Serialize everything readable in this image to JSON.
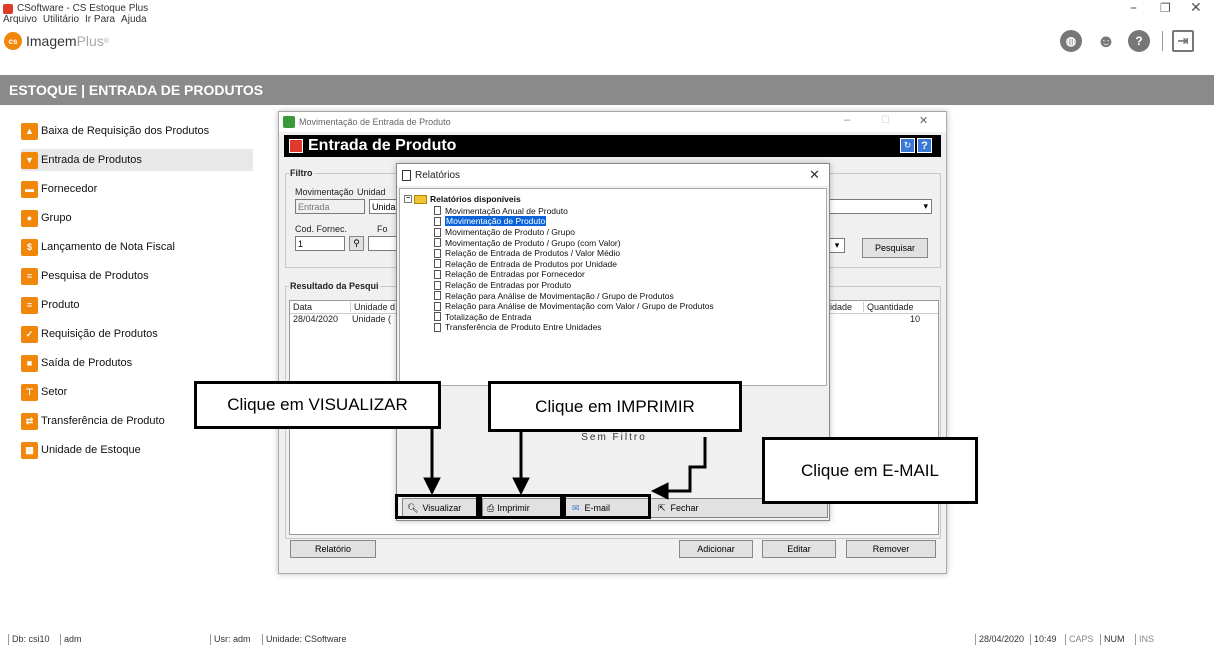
{
  "app": {
    "title": "CSoftware - CS Estoque Plus",
    "menu": [
      "Arquivo",
      "Utilitário",
      "Ir Para",
      "Ajuda"
    ],
    "brand_a": "Imagem",
    "brand_b": "Plus",
    "brand_mark": "®"
  },
  "banner": "ESTOQUE | ENTRADA DE PRODUTOS",
  "sidebar": [
    {
      "label": "Baixa de Requisição dos Produtos",
      "icon": "box-up-icon"
    },
    {
      "label": "Entrada de Produtos",
      "icon": "box-open-icon"
    },
    {
      "label": "Fornecedor",
      "icon": "truck-icon"
    },
    {
      "label": "Grupo",
      "icon": "people-icon"
    },
    {
      "label": "Lançamento de Nota Fiscal",
      "icon": "dollar-icon"
    },
    {
      "label": "Pesquisa de Produtos",
      "icon": "database-icon"
    },
    {
      "label": "Produto",
      "icon": "database-icon"
    },
    {
      "label": "Requisição de Produtos",
      "icon": "check-icon"
    },
    {
      "label": "Saída de Produtos",
      "icon": "box-out-icon"
    },
    {
      "label": "Setor",
      "icon": "org-chart-icon"
    },
    {
      "label": "Transferência de Produto",
      "icon": "transfer-icon"
    },
    {
      "label": "Unidade de Estoque",
      "icon": "stock-icon"
    }
  ],
  "movwin": {
    "title": "Movimentação de Entrada de Produto",
    "heading": "Entrada de Produto",
    "filtro": "Filtro",
    "mov_label": "Movimentação",
    "mov_value": "Entrada",
    "unid_label": "Unidad",
    "unid_value": "Unida",
    "cod_label": "Cod. Fornec.",
    "cod_value": "1",
    "fo_label": "Fo",
    "pesquisar": "Pesquisar",
    "resultado": "Resultado da Pesqui",
    "cols": [
      "Data",
      "Unidade d",
      "idade",
      "Quantidade"
    ],
    "row": {
      "data": "28/04/2020",
      "unidade": "Unidade (",
      "qtd": "10"
    },
    "buttons": {
      "relatorio": "Relatório",
      "adicionar": "Adicionar",
      "editar": "Editar",
      "remover": "Remover"
    }
  },
  "dialog": {
    "title": "Relatórios",
    "root": "Relatórios disponíveis",
    "items": [
      "Movimentação Anual de Produto",
      "Movimentação de Produto",
      "Movimentação de Produto / Grupo",
      "Movimentação de Produto / Grupo (com Valor)",
      "Relação de Entrada de Produtos / Valor Médio",
      "Relação de Entrada de Produtos por Unidade",
      "Relação de Entradas por Fornecedor",
      "Relação de Entradas por Produto",
      "Relação para Análise de Movimentação / Grupo de Produtos",
      "Relação para Análise de Movimentação com Valor  / Grupo de Produtos",
      "Totalização de Entrada",
      "Transferência de Produto Entre Unidades"
    ],
    "selected_index": 1,
    "filter_text": "Sem Filtro",
    "buttons": {
      "visualizar": "Visualizar",
      "imprimir": "Imprimir",
      "email": "E-mail",
      "fechar": "Fechar"
    }
  },
  "callouts": {
    "visualizar": "Clique em VISUALIZAR",
    "imprimir": "Clique em IMPRIMIR",
    "email": "Clique em E-MAIL"
  },
  "status": {
    "db": "Db: csi10",
    "user": "adm",
    "usr": "Usr: adm",
    "unidade": "Unidade: CSoftware",
    "date": "28/04/2020",
    "time": "10:49",
    "caps": "CAPS",
    "num": "NUM",
    "ins": "INS"
  },
  "colors": {
    "accent": "#f0860a",
    "banner": "#8a8a8a",
    "selection": "#0a64d8"
  }
}
